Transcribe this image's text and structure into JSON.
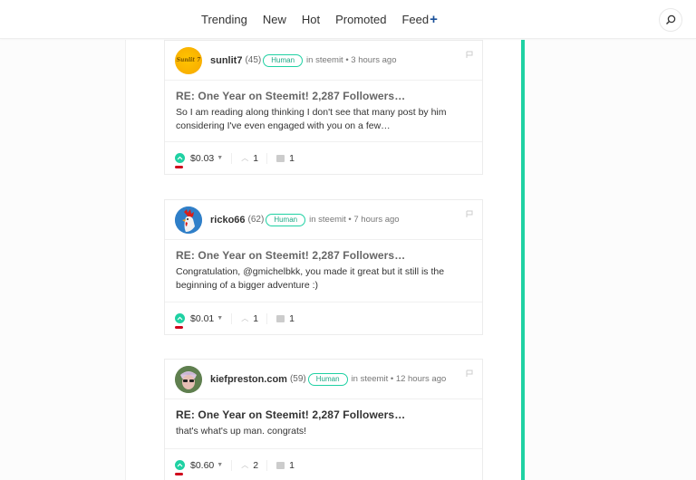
{
  "header": {
    "nav": [
      {
        "label": "Trending"
      },
      {
        "label": "New"
      },
      {
        "label": "Hot"
      },
      {
        "label": "Promoted"
      },
      {
        "label": "Feed",
        "suffix": "+"
      }
    ],
    "search_icon": "search-icon"
  },
  "colors": {
    "accent": "#1fd1a3",
    "feed_plus": "#1a5099",
    "vote_mark": "#d0021b"
  },
  "comments": [
    {
      "author": "sunlit7",
      "reputation": "(45)",
      "badge": "Human",
      "meta": "in steemit • 3 hours ago",
      "title": "RE: One Year on Steemit! 2,287 Followers…",
      "body": "So I am reading along thinking I don't see that many post by him considering I've even engaged with you on a few…",
      "payout": "$0.03",
      "votes": "1",
      "replies": "1",
      "avatar_text": "Sunlit 7"
    },
    {
      "author": "ricko66",
      "reputation": "(62)",
      "badge": "Human",
      "meta": "in steemit • 7 hours ago",
      "title": "RE: One Year on Steemit! 2,287 Followers…",
      "body": "Congratulation, @gmichelbkk, you made it great but it still is the beginning of a bigger adventure :)",
      "payout": "$0.01",
      "votes": "1",
      "replies": "1"
    },
    {
      "author": "kiefpreston.com",
      "reputation": "(59)",
      "badge": "Human",
      "meta": "in steemit • 12 hours ago",
      "title": "RE: One Year on Steemit! 2,287 Followers…",
      "body": "that's what's up man. congrats!",
      "payout": "$0.60",
      "votes": "2",
      "replies": "1"
    }
  ]
}
